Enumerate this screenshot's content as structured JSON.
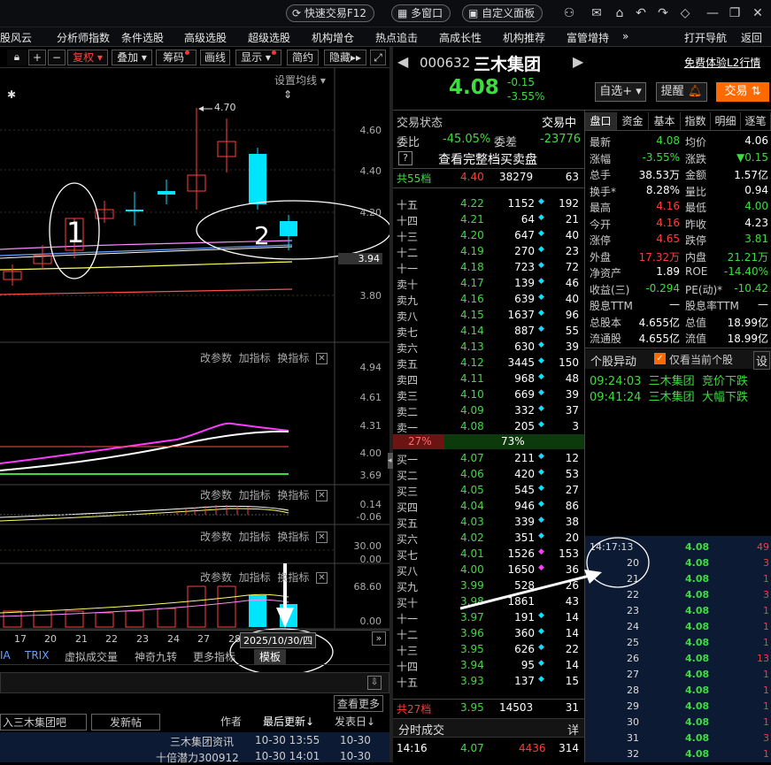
{
  "topbar": {
    "quick_trade": "快速交易F12",
    "multi_window": "多窗口",
    "custom_panel": "自定义面板"
  },
  "menu": [
    "股风云",
    "分析师指数",
    "条件选股",
    "高级选股",
    "超级选股",
    "机构增仓",
    "热点追击",
    "高成长性",
    "机构推荐",
    "富管增持",
    "»",
    "打开导航",
    "返回"
  ],
  "left_toolbar": {
    "fuquan": "复权",
    "diejia": "叠加",
    "chouma": "筹码",
    "huaxian": "画线",
    "xianshi": "显示",
    "jianyue": "简约",
    "yincang": "隐藏▸▸",
    "settings_ma": "设置均线"
  },
  "kline": {
    "high_label": "4.70",
    "price_axis": [
      "4.60",
      "4.40",
      "4.20",
      "3.94",
      "3.80"
    ],
    "annotation1": "1",
    "annotation2": "2"
  },
  "panel_ctl": {
    "a": "改参数",
    "b": "加指标",
    "c": "换指标"
  },
  "panel1_axis": [
    "4.94",
    "4.61",
    "4.31",
    "4.00",
    "3.69"
  ],
  "panel2_axis": [
    "0.14",
    "-0.06"
  ],
  "panel3_axis": [
    "30.00",
    "0.00"
  ],
  "panel4_axis": [
    "68.60",
    "0.00"
  ],
  "dates": [
    "17",
    "20",
    "21",
    "22",
    "23",
    "24",
    "27",
    "28"
  ],
  "cursor_date": "2025/10/30/四",
  "bottom_tabs": [
    "IA",
    "TRIX",
    "虚拟成交量",
    "神奇九转",
    "更多指标",
    "模板"
  ],
  "forum": {
    "post_prefix": "入三木集团吧",
    "post_btn": "发新帖",
    "author": "作者",
    "last_update": "最后更新↓",
    "post_date": "发表日↓",
    "more": "查看更多",
    "rows": [
      {
        "title": "三木集团资讯",
        "t1": "10-30 13:55",
        "t2": "10-30"
      },
      {
        "title": "十倍潜力300912",
        "t1": "10-30 14:01",
        "t2": "10-30"
      }
    ]
  },
  "stock": {
    "code": "000632",
    "name": "三木集团",
    "price": "4.08",
    "change": "-0.15",
    "change_pct": "-3.55%",
    "free_l2": "免费体验L2行情",
    "zixuan": "自选+",
    "tixing": "提醒",
    "jiaoyi": "交易"
  },
  "orderbook": {
    "status_label": "交易状态",
    "status": "交易中",
    "weibi_label": "委比",
    "weibi": "-45.05%",
    "weicha_label": "委差",
    "weicha": "-23776",
    "full_btn": "查看完整档买卖盘",
    "sell_total": {
      "label": "共55档",
      "price": "4.40",
      "vol": "38279",
      "n": "63"
    },
    "sells": [
      {
        "l": "十五",
        "p": "4.22",
        "v": "1152",
        "m": "cyan",
        "n": "192"
      },
      {
        "l": "十四",
        "p": "4.21",
        "v": "64",
        "m": "cyan",
        "n": "21"
      },
      {
        "l": "十三",
        "p": "4.20",
        "v": "647",
        "m": "cyan",
        "n": "40"
      },
      {
        "l": "十二",
        "p": "4.19",
        "v": "270",
        "m": "cyan",
        "n": "23"
      },
      {
        "l": "十一",
        "p": "4.18",
        "v": "723",
        "m": "cyan",
        "n": "72"
      },
      {
        "l": "卖十",
        "p": "4.17",
        "v": "139",
        "m": "cyan",
        "n": "46"
      },
      {
        "l": "卖九",
        "p": "4.16",
        "v": "639",
        "m": "cyan",
        "n": "40"
      },
      {
        "l": "卖八",
        "p": "4.15",
        "v": "1637",
        "m": "cyan",
        "n": "96"
      },
      {
        "l": "卖七",
        "p": "4.14",
        "v": "887",
        "m": "cyan",
        "n": "55"
      },
      {
        "l": "卖六",
        "p": "4.13",
        "v": "630",
        "m": "cyan",
        "n": "39"
      },
      {
        "l": "卖五",
        "p": "4.12",
        "v": "3445",
        "m": "cyan",
        "n": "150"
      },
      {
        "l": "卖四",
        "p": "4.11",
        "v": "968",
        "m": "cyan",
        "n": "48"
      },
      {
        "l": "卖三",
        "p": "4.10",
        "v": "669",
        "m": "cyan",
        "n": "39"
      },
      {
        "l": "卖二",
        "p": "4.09",
        "v": "332",
        "m": "cyan",
        "n": "37"
      },
      {
        "l": "卖一",
        "p": "4.08",
        "v": "205",
        "m": "cyan",
        "n": "3"
      }
    ],
    "ratio_left": "27%",
    "ratio_right": "73%",
    "buys": [
      {
        "l": "买一",
        "p": "4.07",
        "v": "211",
        "m": "cyan",
        "n": "12"
      },
      {
        "l": "买二",
        "p": "4.06",
        "v": "420",
        "m": "cyan",
        "n": "53"
      },
      {
        "l": "买三",
        "p": "4.05",
        "v": "545",
        "m": "cyan",
        "n": "27"
      },
      {
        "l": "买四",
        "p": "4.04",
        "v": "946",
        "m": "cyan",
        "n": "86"
      },
      {
        "l": "买五",
        "p": "4.03",
        "v": "339",
        "m": "cyan",
        "n": "38"
      },
      {
        "l": "买六",
        "p": "4.02",
        "v": "351",
        "m": "cyan",
        "n": "20"
      },
      {
        "l": "买七",
        "p": "4.01",
        "v": "1526",
        "m": "magenta",
        "n": "153"
      },
      {
        "l": "买八",
        "p": "4.00",
        "v": "1650",
        "m": "magenta",
        "n": "36"
      },
      {
        "l": "买九",
        "p": "3.99",
        "v": "528",
        "m": "",
        "n": "26"
      },
      {
        "l": "买十",
        "p": "3.98",
        "v": "1861",
        "m": "",
        "n": "43"
      },
      {
        "l": "十一",
        "p": "3.97",
        "v": "191",
        "m": "cyan",
        "n": "14"
      },
      {
        "l": "十二",
        "p": "3.96",
        "v": "360",
        "m": "cyan",
        "n": "14"
      },
      {
        "l": "十三",
        "p": "3.95",
        "v": "626",
        "m": "cyan",
        "n": "22"
      },
      {
        "l": "十四",
        "p": "3.94",
        "v": "95",
        "m": "cyan",
        "n": "14"
      },
      {
        "l": "十五",
        "p": "3.93",
        "v": "137",
        "m": "cyan",
        "n": "15"
      }
    ],
    "buy_total": {
      "label": "共27档",
      "price": "3.95",
      "vol": "14503",
      "n": "31"
    },
    "ticks_label": "分时成交",
    "ticks_detail": "详",
    "last_tick": {
      "t": "14:16",
      "p": "4.07",
      "v": "4436",
      "n": "314"
    }
  },
  "quote_tabs": [
    "盘口",
    "资金",
    "基本",
    "指数",
    "明细",
    "逐笔"
  ],
  "quote": [
    [
      "最新",
      "4.08",
      "均价",
      "4.06"
    ],
    [
      "涨幅",
      "-3.55%",
      "涨跌",
      "▼0.15"
    ],
    [
      "总手",
      "38.53万",
      "金额",
      "1.57亿"
    ],
    [
      "换手*",
      "8.28%",
      "量比",
      "0.94"
    ],
    [
      "最高",
      "4.16",
      "最低",
      "4.00"
    ],
    [
      "今开",
      "4.16",
      "昨收",
      "4.23"
    ],
    [
      "涨停",
      "4.65",
      "跌停",
      "3.81"
    ],
    [
      "外盘",
      "17.32万",
      "内盘",
      "21.21万"
    ],
    [
      "净资产",
      "1.89",
      "ROE",
      "-14.40%"
    ],
    [
      "收益(三)",
      "-0.294",
      "PE(动)*",
      "-10.42"
    ],
    [
      "股息TTM",
      "—",
      "股息率TTM",
      "—"
    ],
    [
      "总股本",
      "4.655亿",
      "总值",
      "18.99亿"
    ],
    [
      "流通股",
      "4.655亿",
      "流值",
      "18.99亿"
    ]
  ],
  "alerts": {
    "title": "个股异动",
    "only_current": "仅看当前个股",
    "settings": "设",
    "rows": [
      {
        "t": "09:24:03",
        "name": "三木集团",
        "type": "竞价下跌"
      },
      {
        "t": "09:41:24",
        "name": "三木集团",
        "type": "大幅下跌"
      }
    ]
  },
  "ticks": [
    {
      "t": "14:17:13",
      "p": "4.08",
      "v": "49"
    },
    {
      "t": "20",
      "p": "4.08",
      "v": "3"
    },
    {
      "t": "21",
      "p": "4.08",
      "v": "1"
    },
    {
      "t": "22",
      "p": "4.08",
      "v": "3"
    },
    {
      "t": "23",
      "p": "4.08",
      "v": "1"
    },
    {
      "t": "24",
      "p": "4.08",
      "v": "1"
    },
    {
      "t": "25",
      "p": "4.08",
      "v": "1"
    },
    {
      "t": "26",
      "p": "4.08",
      "v": "13"
    },
    {
      "t": "27",
      "p": "4.08",
      "v": "1"
    },
    {
      "t": "28",
      "p": "4.08",
      "v": "1"
    },
    {
      "t": "29",
      "p": "4.08",
      "v": "1"
    },
    {
      "t": "30",
      "p": "4.08",
      "v": "1"
    },
    {
      "t": "31",
      "p": "4.08",
      "v": "3"
    },
    {
      "t": "32",
      "p": "4.08",
      "v": "1"
    }
  ],
  "colors": {
    "up": "#ff3b3b",
    "down": "#3fdc3f",
    "cyan": "#00e5ff",
    "magenta": "#ff3bff",
    "accent": "#ff6a00"
  }
}
